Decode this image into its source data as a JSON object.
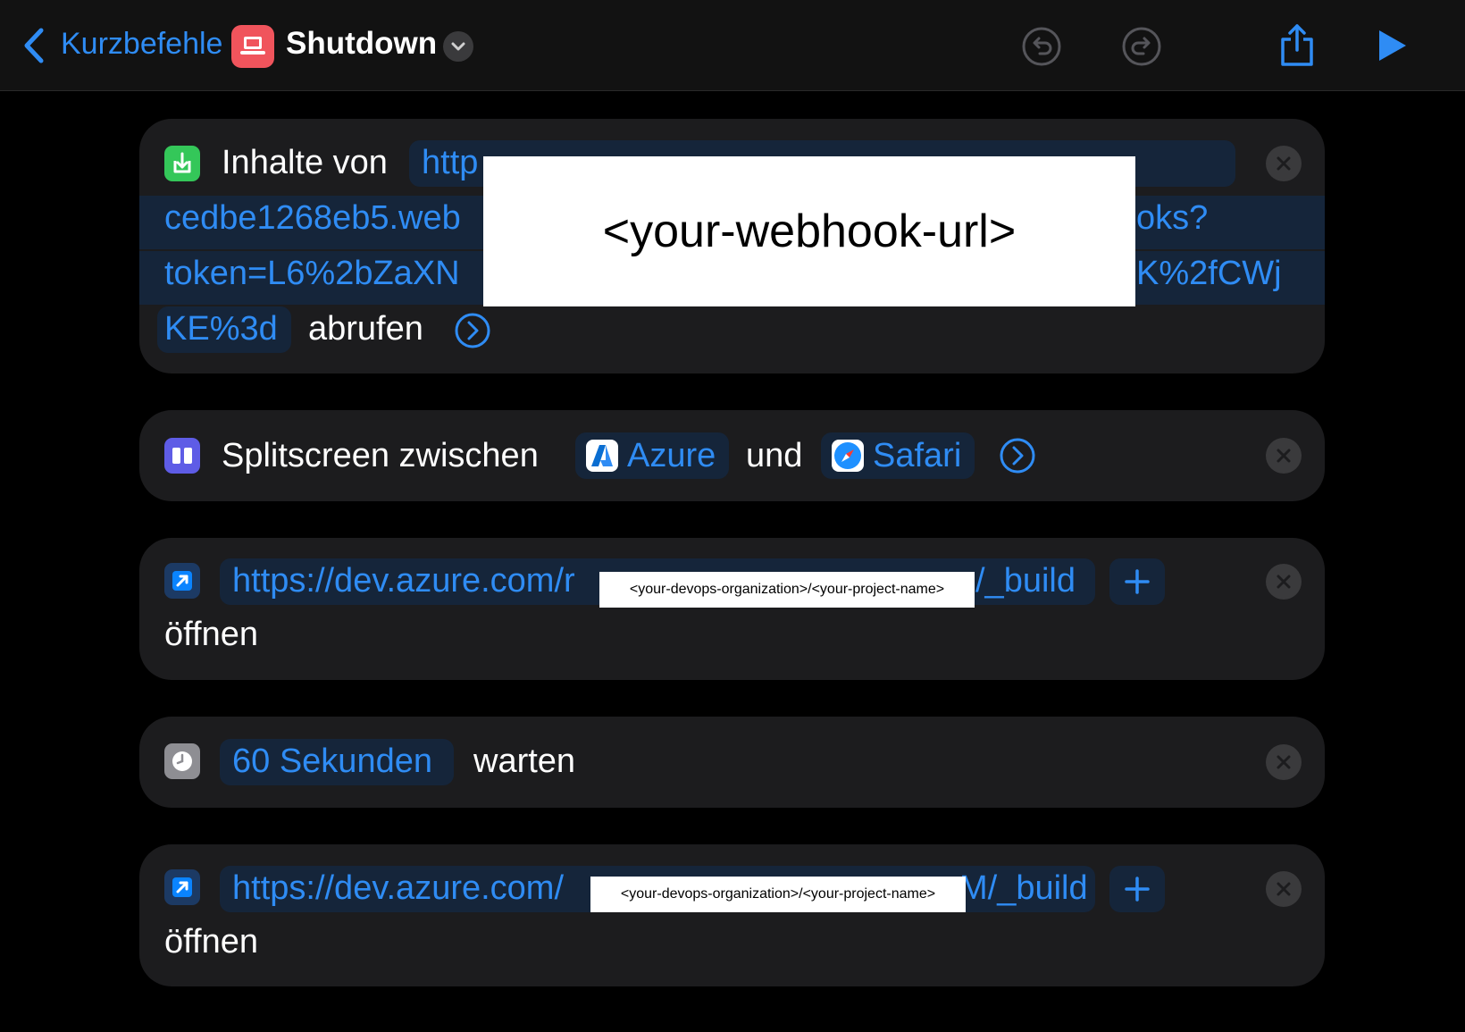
{
  "topbar": {
    "back_label": "Kurzbefehle",
    "title": "Shutdown",
    "app_icon": "laptop-icon",
    "app_icon_color": "#f0545c",
    "accent_color": "#2f8cf4"
  },
  "actions": [
    {
      "icon": "download-icon",
      "icon_color": "#34c759",
      "label": "Inhalte von",
      "url_lines": [
        "http",
        "cedbe1268eb5.web",
        "token=L6%2bZaXN",
        "KE%3d"
      ],
      "url_tail_lines": [
        "oks?",
        "K%2fCWj"
      ],
      "redaction": "<your-webhook-url>",
      "suffix": "abrufen"
    },
    {
      "icon": "splitscreen-icon",
      "icon_color": "#5e5ce6",
      "label": "Splitscreen zwischen",
      "app1": "Azure",
      "connector": "und",
      "app2": "Safari"
    },
    {
      "icon": "open-url-icon",
      "icon_color": "#0a84ff",
      "url_start": "https://dev.azure.com/r",
      "url_end": "/_build",
      "redaction": "<your-devops-organization>/<your-project-name>",
      "suffix": "öffnen"
    },
    {
      "icon": "clock-icon",
      "icon_color": "#8e8e93",
      "duration": "60 Sekunden",
      "label": "warten"
    },
    {
      "icon": "open-url-icon",
      "icon_color": "#0a84ff",
      "url_start": "https://dev.azure.com/",
      "url_end": "M/_build",
      "redaction": "<your-devops-organization>/<your-project-name>",
      "suffix": "öffnen"
    }
  ]
}
